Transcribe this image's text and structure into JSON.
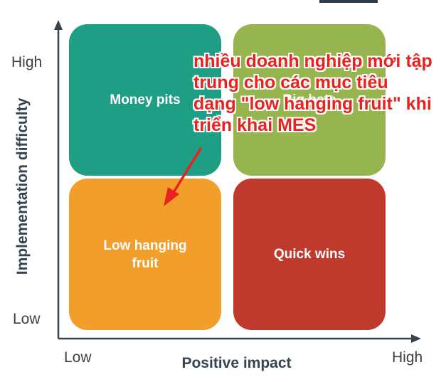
{
  "matrix": {
    "quadrants": {
      "top_left": "Money pits",
      "top_right": "Big bets",
      "bottom_left": "Low hanging fruit",
      "bottom_right": "Quick wins"
    },
    "x_axis": {
      "label": "Positive impact",
      "low": "Low",
      "high": "High"
    },
    "y_axis": {
      "label": "Implementation difficulty",
      "low": "Low",
      "high": "High"
    }
  },
  "annotation": {
    "text": "nhiều doanh nghiệp mới tập trung cho các mục tiêu dạng \"low hanging fruit\" khi triển khai MES",
    "color": "#e8231f"
  },
  "colors": {
    "money_pits": "#1f9e86",
    "big_bets": "#97b54e",
    "low_hanging_fruit": "#f29e2b",
    "quick_wins": "#c0392d",
    "axis": "#35444f"
  }
}
